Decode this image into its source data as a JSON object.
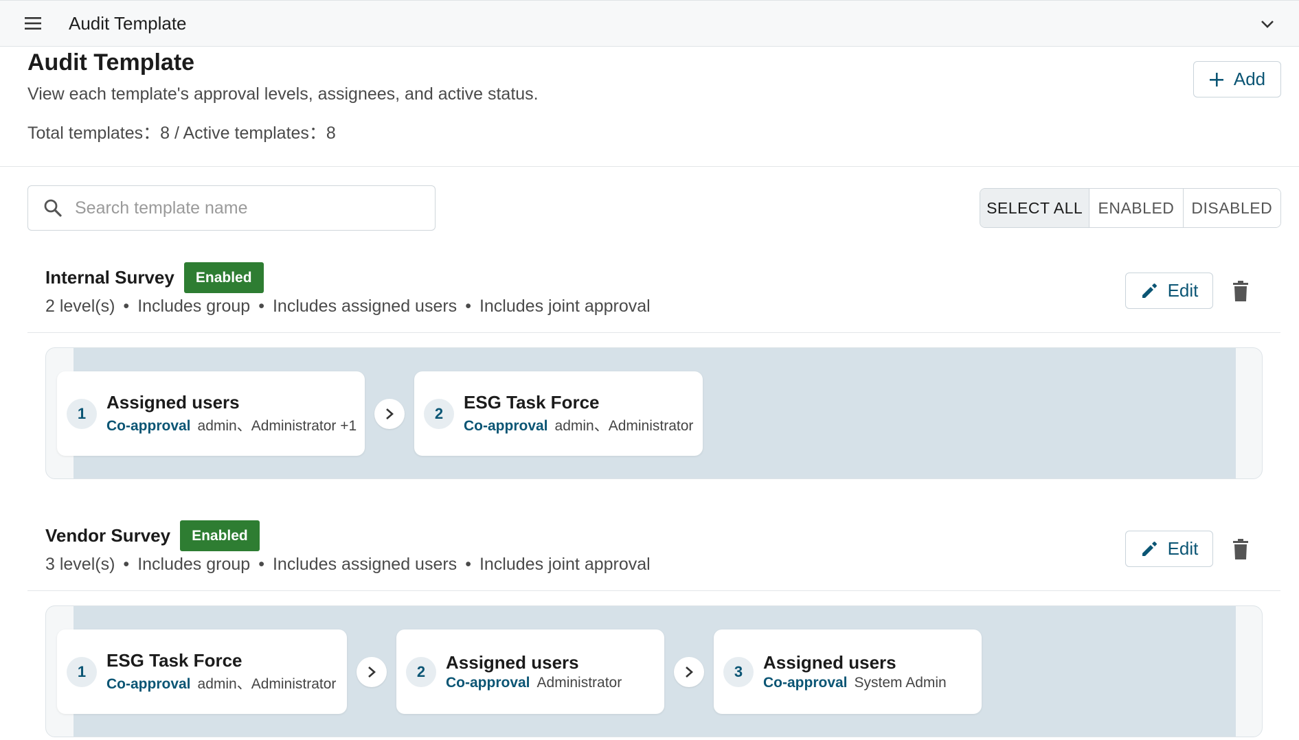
{
  "topbar": {
    "title": "Audit Template"
  },
  "header": {
    "title": "Audit Template",
    "description": "View each template's approval levels, assignees, and active status.",
    "stats": "Total templates：8  /  Active templates：8",
    "add_label": "Add"
  },
  "search": {
    "placeholder": "Search template name",
    "value": ""
  },
  "filters": {
    "select_all": "SELECT ALL",
    "enabled": "ENABLED",
    "disabled": "DISABLED",
    "active": "SELECT ALL"
  },
  "templates": [
    {
      "name": "Internal Survey",
      "status": "Enabled",
      "meta": [
        "2 level(s)",
        "Includes group",
        "Includes assigned users",
        "Includes joint approval"
      ],
      "edit_label": "Edit",
      "levels": [
        {
          "num": "1",
          "title": "Assigned users",
          "mode": "Co-approval",
          "assignees": "admin、Administrator +1"
        },
        {
          "num": "2",
          "title": "ESG Task Force",
          "mode": "Co-approval",
          "assignees": "admin、Administrator"
        }
      ]
    },
    {
      "name": "Vendor Survey",
      "status": "Enabled",
      "meta": [
        "3 level(s)",
        "Includes group",
        "Includes assigned users",
        "Includes joint approval"
      ],
      "edit_label": "Edit",
      "levels": [
        {
          "num": "1",
          "title": "ESG Task Force",
          "mode": "Co-approval",
          "assignees": "admin、Administrator"
        },
        {
          "num": "2",
          "title": "Assigned users",
          "mode": "Co-approval",
          "assignees": "Administrator"
        },
        {
          "num": "3",
          "title": "Assigned users",
          "mode": "Co-approval",
          "assignees": "System Admin"
        }
      ]
    }
  ],
  "colors": {
    "accent": "#0b5574",
    "enabled_badge": "#2e7d32",
    "flow_bg": "#d6e1e8"
  },
  "icons": [
    "menu-icon",
    "chevron-down-icon",
    "plus-icon",
    "search-icon",
    "pencil-icon",
    "trash-icon",
    "chevron-right-icon"
  ]
}
